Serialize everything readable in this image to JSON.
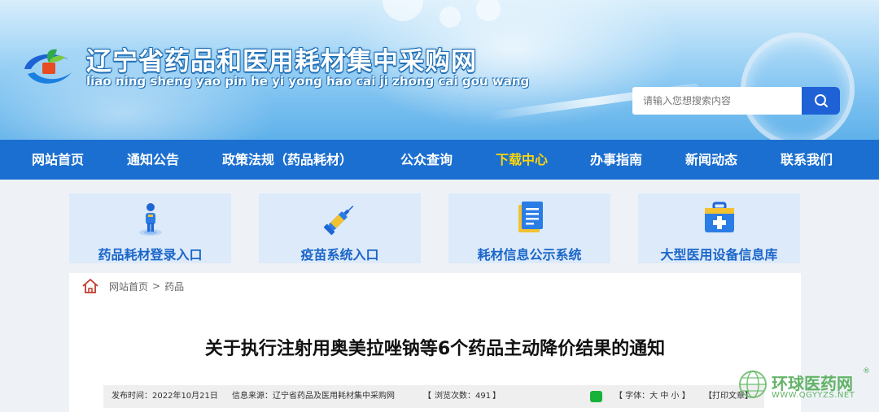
{
  "header": {
    "site_title": "辽宁省药品和医用耗材集中采购网",
    "site_pinyin": "liao ning sheng yao pin he yi yong hao cai ji zhong cai gou wang",
    "logo_icon": "logo-icon"
  },
  "search": {
    "placeholder": "请输入您想搜索内容",
    "button_icon": "search-icon"
  },
  "nav": {
    "items": [
      {
        "label": "网站首页"
      },
      {
        "label": "通知公告"
      },
      {
        "label": "政策法规（药品耗材）"
      },
      {
        "label": "公众查询"
      },
      {
        "label": "下载中心"
      },
      {
        "label": "办事指南"
      },
      {
        "label": "新闻动态"
      },
      {
        "label": "联系我们"
      }
    ],
    "active_label": "下载中心",
    "colors": {
      "bar": "#1b6fd0",
      "active": "#ffd60a"
    }
  },
  "quick_links": [
    {
      "label": "药品耗材登录入口",
      "icon": "user-icon"
    },
    {
      "label": "疫苗系统入口",
      "icon": "syringe-icon"
    },
    {
      "label": "耗材信息公示系统",
      "icon": "document-icon"
    },
    {
      "label": "大型医用设备信息库",
      "icon": "medical-kit-icon"
    }
  ],
  "breadcrumb": {
    "home_icon": "home-icon",
    "items": [
      "网站首页",
      "药品"
    ],
    "separator": ">"
  },
  "article": {
    "title": "关于执行注射用奥美拉唑钠等6个药品主动降价结果的通知",
    "publish_time": "发布时间：2022年10月21日",
    "source": "信息来源：辽宁省药品及医用耗材集中采购网",
    "views_open": "【",
    "views": "浏览次数：491",
    "views_close": "】",
    "font_size_label": "【 字体：大 中 小 】",
    "print_label": "【打印文章】"
  },
  "watermark": {
    "name": "环球医药网",
    "url": "WWW.QGYYZS.NET",
    "reg": "®"
  }
}
